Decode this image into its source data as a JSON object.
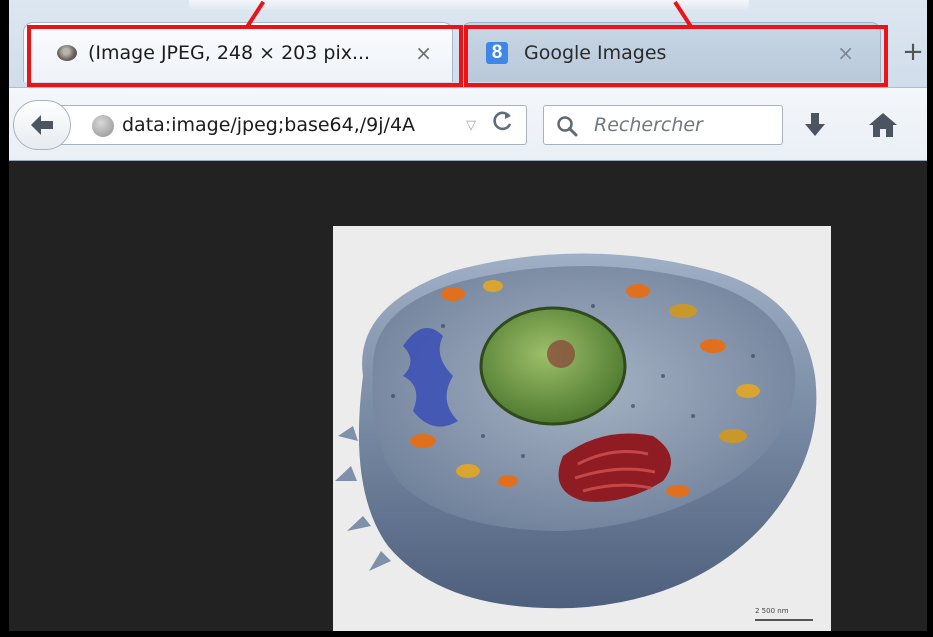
{
  "tabs": [
    {
      "label": "(Image JPEG, 248 × 203 pix...",
      "close": "×",
      "icon": "image-thumbnail-icon",
      "active": true
    },
    {
      "label": "Google Images",
      "close": "×",
      "icon": "google-favicon-icon",
      "active": false,
      "favicon_letter": "8"
    }
  ],
  "newtab_label": "+",
  "toolbar": {
    "url": "data:image/jpeg;base64,/9j/4A",
    "search_placeholder": "Rechercher",
    "reload_glyph": "C",
    "dropdown_glyph": "▽"
  },
  "content": {
    "image_alt": "3D cutaway model of an animal cell",
    "scale_label": "2 500 nm"
  },
  "colors": {
    "highlight": "#e8141a",
    "content_background": "#222222",
    "google_favicon": "#3e86e8"
  }
}
